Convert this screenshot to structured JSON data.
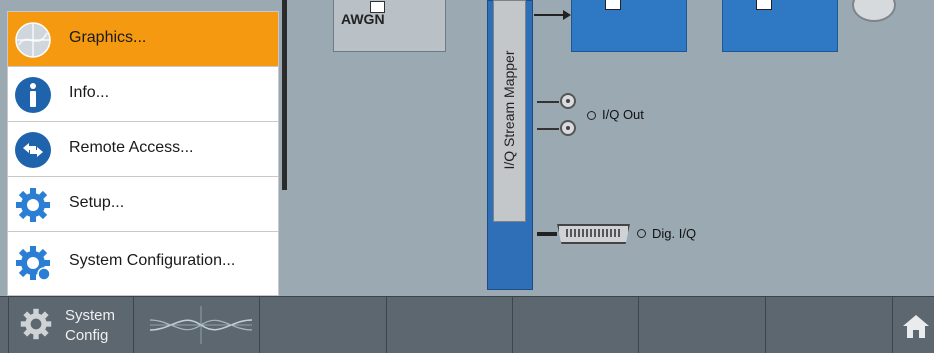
{
  "menu": {
    "items": [
      {
        "label": "Graphics...",
        "icon": "graphics-icon",
        "active": true
      },
      {
        "label": "Info...",
        "icon": "info-icon",
        "active": false
      },
      {
        "label": "Remote Access...",
        "icon": "remote-access-icon",
        "active": false
      },
      {
        "label": "Setup...",
        "icon": "setup-gear-icon",
        "active": false
      },
      {
        "label": "System Configuration...",
        "icon": "system-configuration-gear-icon",
        "active": false
      }
    ]
  },
  "diagram": {
    "awgn_label": "AWGN",
    "mapper_label": "I/Q Stream Mapper",
    "iq_out_label": "I/Q Out",
    "dig_iq_label": "Dig. I/Q"
  },
  "taskbar": {
    "system_config_line1": "System",
    "system_config_line2": "Config"
  },
  "colors": {
    "accent": "#f59a10",
    "block_blue": "#2e78c4",
    "taskbar": "#5d6770"
  }
}
